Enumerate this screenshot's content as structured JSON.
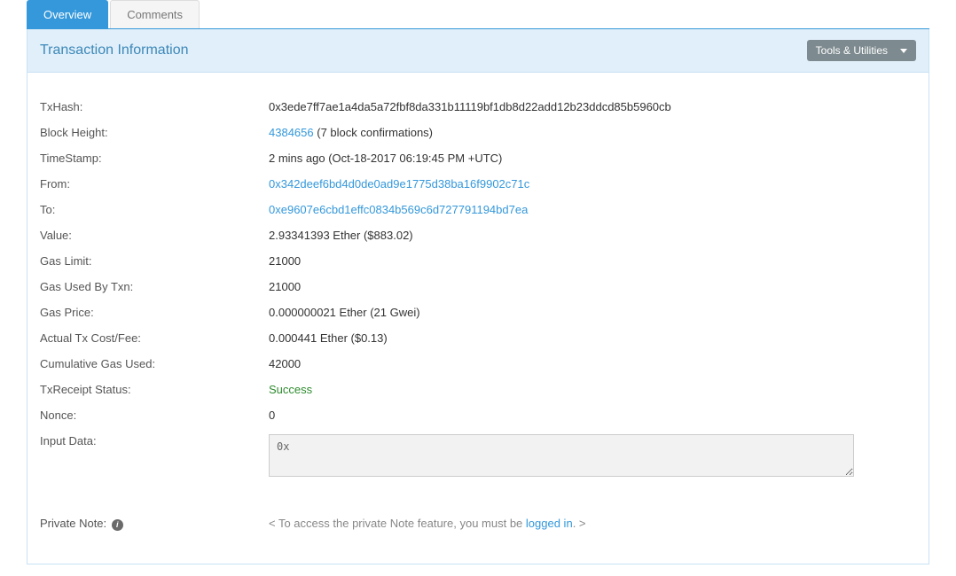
{
  "tabs": {
    "overview": "Overview",
    "comments": "Comments"
  },
  "title": "Transaction Information",
  "tools_btn": "Tools & Utilities",
  "labels": {
    "txhash": "TxHash:",
    "block_height": "Block Height:",
    "timestamp": "TimeStamp:",
    "from": "From:",
    "to": "To:",
    "value": "Value:",
    "gas_limit": "Gas Limit:",
    "gas_used": "Gas Used By Txn:",
    "gas_price": "Gas Price:",
    "actual_cost": "Actual Tx Cost/Fee:",
    "cum_gas": "Cumulative Gas Used:",
    "receipt": "TxReceipt Status:",
    "nonce": "Nonce:",
    "input_data": "Input Data:",
    "private_note": "Private Note:"
  },
  "values": {
    "txhash": "0x3ede7ff7ae1a4da5a72fbf8da331b11119bf1db8d22add12b23ddcd85b5960cb",
    "block_height_link": "4384656",
    "block_height_rest": " (7 block confirmations)",
    "timestamp": "2 mins ago (Oct-18-2017 06:19:45 PM +UTC)",
    "from": "0x342deef6bd4d0de0ad9e1775d38ba16f9902c71c",
    "to": "0xe9607e6cbd1effc0834b569c6d727791194bd7ea",
    "value": "2.93341393 Ether ($883.02)",
    "gas_limit": "21000",
    "gas_used": "21000",
    "gas_price": "0.000000021 Ether (21 Gwei)",
    "actual_cost": "0.000441 Ether ($0.13)",
    "cum_gas": "42000",
    "receipt": "Success",
    "nonce": "0",
    "input_data": "0x"
  },
  "private_note": {
    "prefix": "< To access the private Note feature, you must be ",
    "link": "logged in",
    "suffix": ". >"
  }
}
